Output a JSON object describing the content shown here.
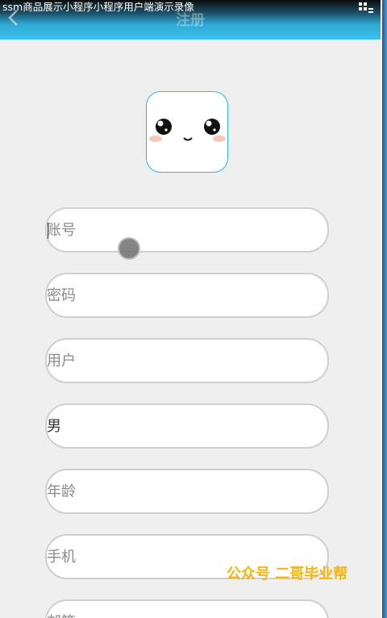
{
  "recording_title": "ssm商品展示小程序小程序用户端演示录像",
  "page_title": "注册",
  "form": {
    "account_placeholder": "账号",
    "password_placeholder": "密码",
    "username_placeholder": "用户",
    "gender_value": "男",
    "age_placeholder": "年龄",
    "phone_placeholder": "手机",
    "email_placeholder": "邮箱"
  },
  "watermark": "公众号 二哥毕业帮",
  "colors": {
    "header_accent": "#3cc0ee",
    "avatar_border": "#29b6e8",
    "watermark": "#f5b40f"
  }
}
